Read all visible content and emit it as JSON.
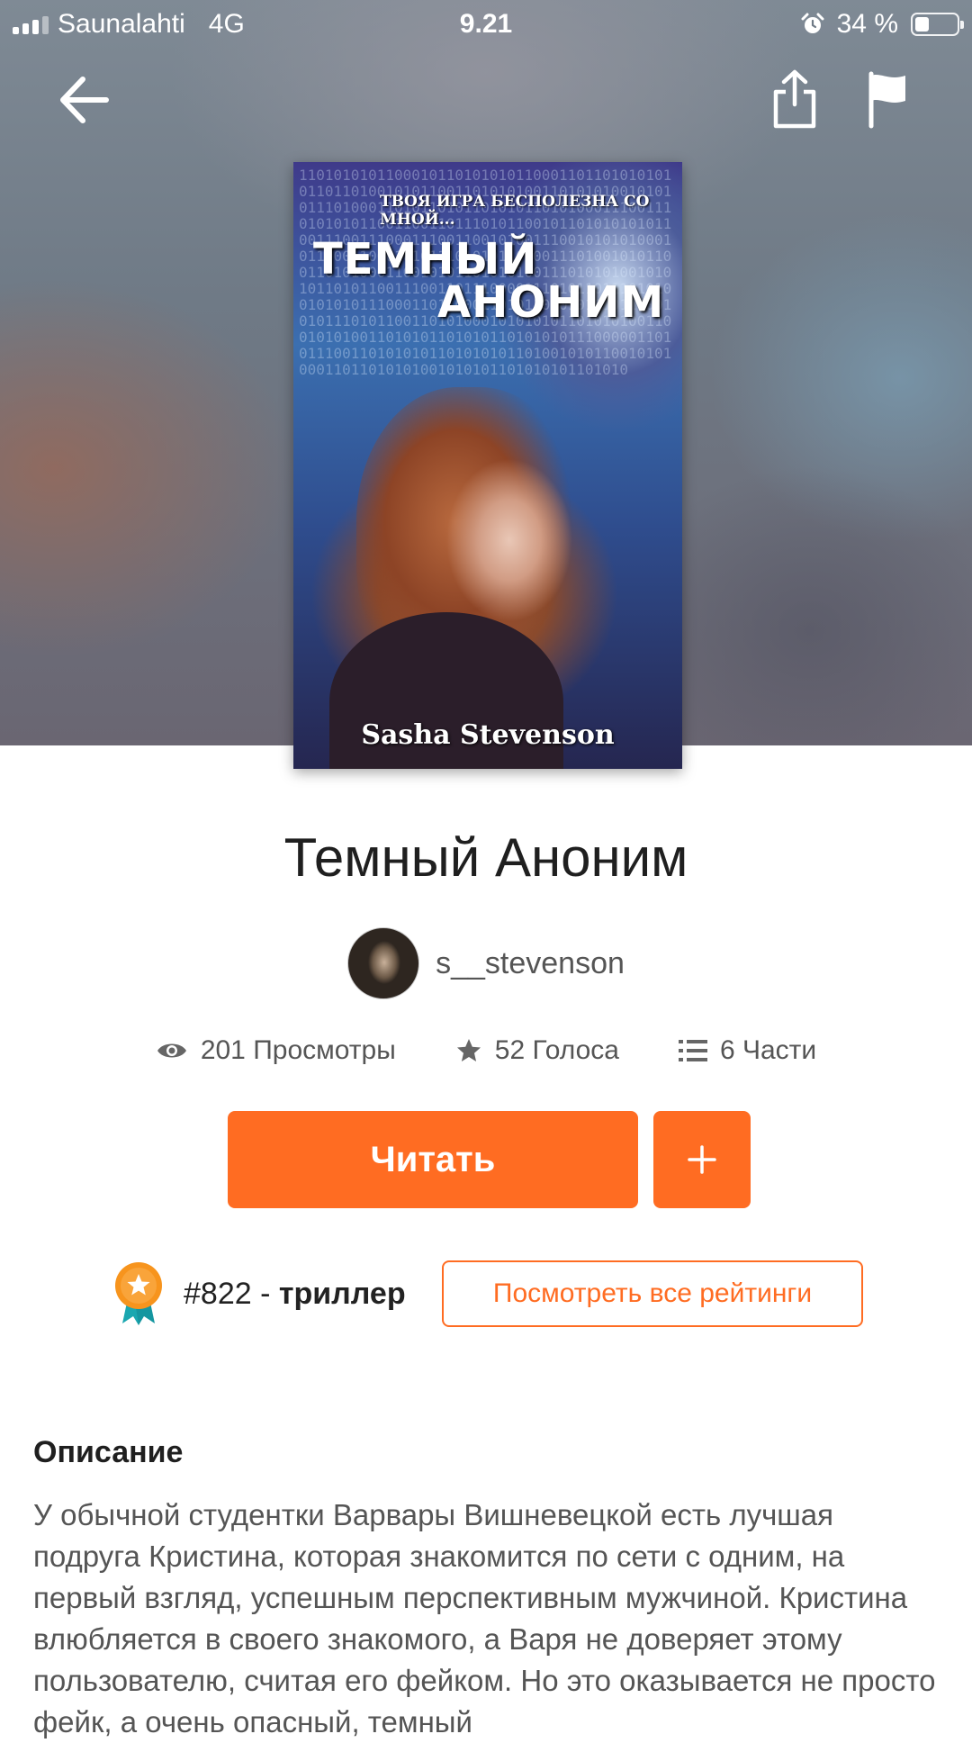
{
  "status_bar": {
    "carrier": "Saunalahti",
    "network": "4G",
    "time": "9.21",
    "battery": "34 %",
    "battery_level": 0.34
  },
  "nav": {
    "icons": [
      "back-arrow-icon",
      "share-icon",
      "flag-icon"
    ]
  },
  "cover": {
    "tagline": "ТВОЯ ИГРА БЕСПОЛЕЗНА СО МНОЙ...",
    "title_line1": "ТЕМНЫЙ",
    "title_line2": "АНОНИМ",
    "author": "Sasha Stevenson",
    "binary": "11010101011000101101010101100011011010101010110110100101011001101010100110101010010101011101000110101101011010101101010001110011101010101100110011011101011001011010101010110011100111000111001100101001110010101010001011000110001010111010101101001110100101011001101010001100101011010101001110101010010101011010110011100110111000011101011011101010010101011100011011000110101101010101011000101011101011001101010001010101011010101001100101010011010101101010110101010111000001101011100110101010110101010110100101011001010100011011010101001010101101010101101010"
  },
  "story": {
    "title": "Темный Аноним",
    "username": "s__stevenson",
    "views": "201 Просмотры",
    "votes": "52 Голоса",
    "parts": "6 Части",
    "read_label": "Читать",
    "add_label": "+",
    "rank_number": "#822 -",
    "rank_genre": "триллер",
    "rankings_label": "Посмотреть все рейтинги"
  },
  "description": {
    "heading": "Описание",
    "text": "У обычной студентки Варвары Вишневецкой есть лучшая подруга Кристина, которая знакомится по сети с одним, на первый взгляд, успешным перспективным мужчиной. Кристина влюбляется в своего знакомого, а Варя не доверяет этому пользователю, считая его фейком. Но это оказывается не просто фейк, а очень опасный, темный"
  },
  "colors": {
    "accent": "#ff6c22",
    "text_dark": "#1f1f1f",
    "text_muted": "#555555",
    "badge_gold": "#f7941d",
    "badge_teal": "#1aa7b0"
  }
}
